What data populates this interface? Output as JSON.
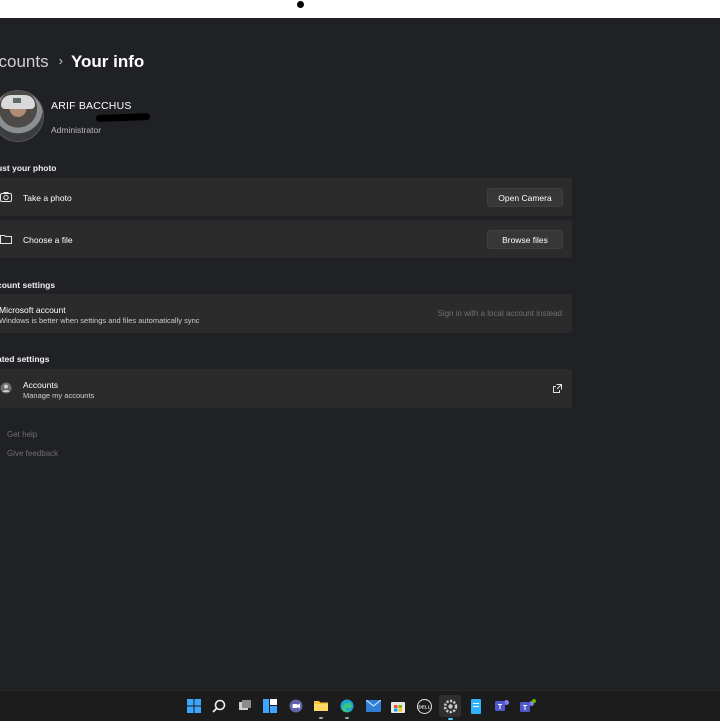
{
  "breadcrumb": {
    "parent": "ccounts",
    "separator": "›",
    "current": "Your info"
  },
  "user": {
    "name": "ARIF BACCHUS",
    "role": "Administrator"
  },
  "photo_section": {
    "title": "ust your photo",
    "items": [
      {
        "label": "Take a photo",
        "icon": "camera-icon",
        "button": "Open Camera"
      },
      {
        "label": "Choose a file",
        "icon": "folder-icon",
        "button": "Browse files"
      }
    ]
  },
  "account_settings": {
    "title": "count settings",
    "item": {
      "label": "Microsoft account",
      "sublabel": "Windows is better when settings and files automatically sync",
      "link": "Sign in with a local account instead"
    }
  },
  "related_settings": {
    "title": "ated settings",
    "item": {
      "label": "Accounts",
      "sublabel": "Manage my accounts",
      "icon": "external-link-icon"
    }
  },
  "footer": {
    "help": "Get help",
    "feedback": "Give feedback"
  },
  "taskbar": {
    "icons": [
      "start-icon",
      "search-icon",
      "task-view-icon",
      "widgets-icon",
      "chat-icon",
      "file-explorer-icon",
      "edge-icon",
      "mail-icon",
      "store-icon",
      "dell-icon",
      "settings-icon",
      "notepad-icon",
      "teams-icon",
      "teams-preview-icon"
    ],
    "dell_text": "DELL"
  },
  "colors": {
    "background": "#202124",
    "card": "#2b2b2b",
    "button": "#373737",
    "taskbar": "#1c1c1c"
  }
}
